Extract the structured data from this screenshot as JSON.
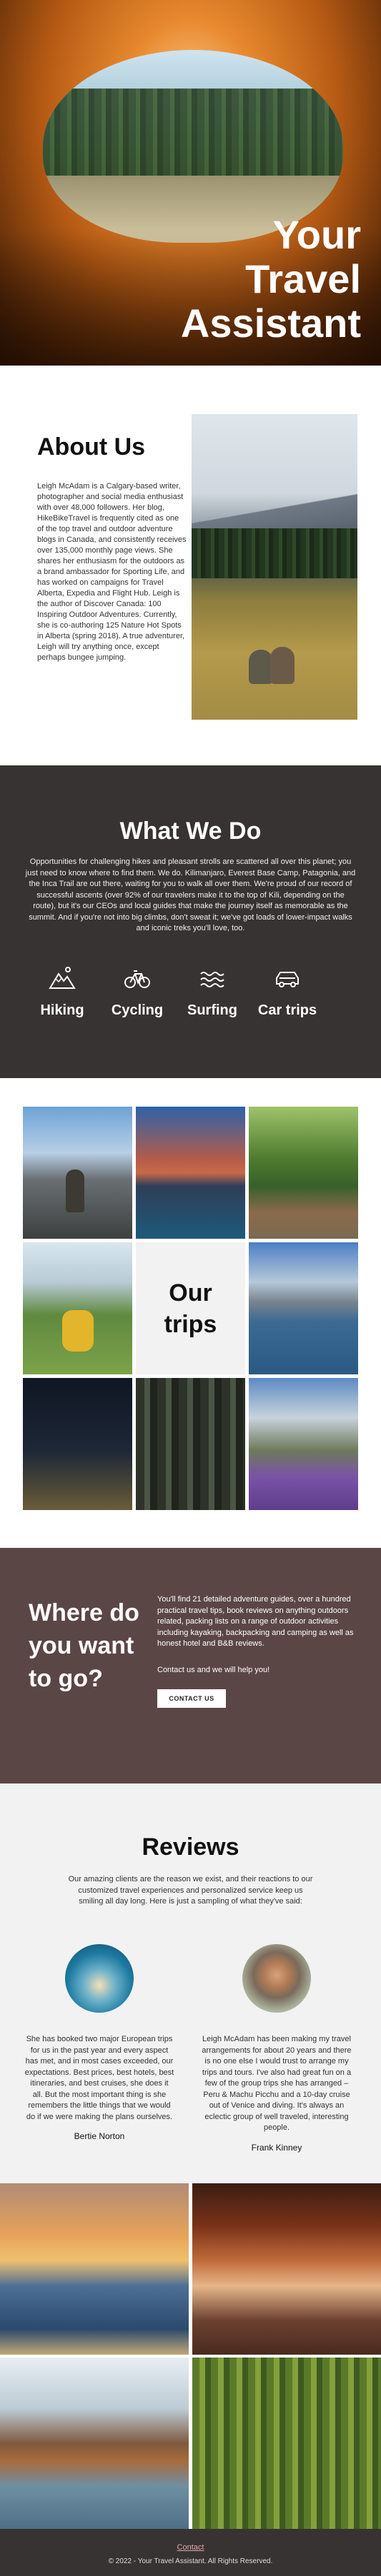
{
  "hero": {
    "title_line1": "Your",
    "title_line2": "Travel",
    "title_line3": "Assistant"
  },
  "about": {
    "title": "About Us",
    "body": "Leigh McAdam is a Calgary-based writer, photographer and social media enthusiast with over 48,000 followers. Her blog, HikeBikeTravel is frequently cited as one of the top travel and outdoor adventure blogs in Canada, and consistently receives over 135,000 monthly page views. She shares her enthusiasm for the outdoors as a brand ambassador for Sporting Life, and has worked on campaigns for Travel Alberta, Expedia and Flight Hub. Leigh is the author of Discover Canada: 100 Inspiring Outdoor Adventures. Currently, she is co-authoring 125 Nature Hot Spots in Alberta (spring 2018). A true adventurer, Leigh will try anything once, except perhaps bungee jumping."
  },
  "what_we_do": {
    "title": "What We Do",
    "body": "Opportunities for challenging hikes and pleasant strolls are scattered all over this planet; you just need to know where to find them. We do. Kilimanjaro, Everest Base Camp, Patagonia, and the Inca Trail are out there, waiting for you to walk all over them. We're proud of our record of successful ascents (over 92% of our travelers make it to the top of Kili, depending on the route), but it's our CEOs and local guides that make the journey itself as memorable as the summit. And if you're not into big climbs, don't sweat it; we've got loads of lower-impact walks and iconic treks you'll love, too.",
    "activities": [
      {
        "label": "Hiking",
        "icon": "mountain-hiking-icon"
      },
      {
        "label": "Cycling",
        "icon": "bicycle-icon"
      },
      {
        "label": "Surfing",
        "icon": "waves-icon"
      },
      {
        "label": "Car trips",
        "icon": "car-icon"
      }
    ]
  },
  "trips": {
    "title_line1": "Our",
    "title_line2": "trips"
  },
  "where": {
    "title": "Where do you want to go?",
    "body": "You'll find 21 detailed adventure guides, over a hundred practical travel tips, book reviews on anything outdoors related, packing lists on a range of outdoor activities including kayaking, backpacking and camping as well as honest hotel and B&B reviews.",
    "help": "Contact us and we will help you!",
    "button": "CONTACT US"
  },
  "reviews": {
    "title": "Reviews",
    "intro": "Our amazing clients are the reason we exist, and their reactions to our customized travel experiences and personalized service keep us smiling all day long. Here is just a sampling of what they've said:",
    "items": [
      {
        "text": "She has booked two major European trips for us in the past year and every aspect has met, and in most cases exceeded, our expectations. Best prices, best hotels, best itineraries, and best cruises, she does it all. But the most important thing is she remembers the little things that we would do if we were making the plans ourselves.",
        "name": "Bertie Norton"
      },
      {
        "text": "Leigh McAdam has been making my travel arrangements for about 20 years and there is no one else I would trust to arrange my trips and tours. I've also had great fun on a few of the group trips she has arranged – Peru & Machu Picchu and a 10-day cruise out of Venice and diving. It's always an eclectic group of well traveled, interesting people.",
        "name": "Frank Kinney"
      }
    ]
  },
  "footer": {
    "link": "Contact",
    "copyright": "© 2022 - Your Travel Assistant. All Rights Reserved."
  },
  "colors": {
    "dark_section": "#373333",
    "where_section": "#5b4646",
    "reviews_bg": "#f2f2f2"
  }
}
